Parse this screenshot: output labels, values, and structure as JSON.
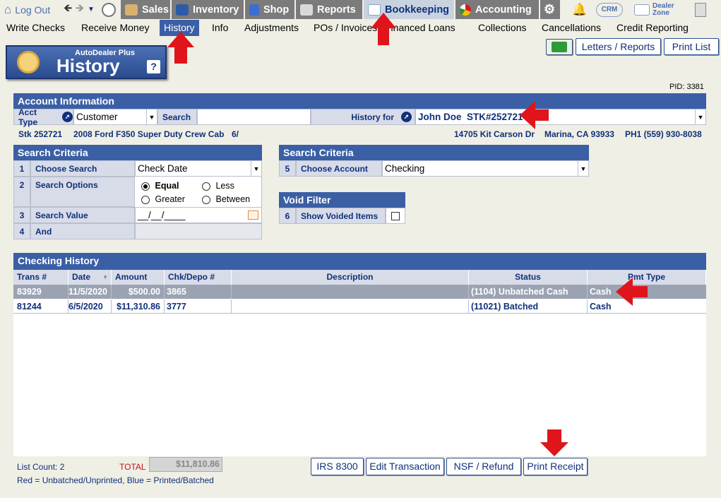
{
  "topbar": {
    "logout": "Log Out",
    "tabs": [
      "Sales",
      "Inventory",
      "Shop",
      "Reports",
      "Bookkeeping",
      "Accounting"
    ],
    "crm": "CRM",
    "dealer_zone": "Dealer Zone"
  },
  "menu": [
    "Write Checks",
    "Receive Money",
    "History",
    "Info",
    "Adjustments",
    "POs / Invoices",
    "Financed Loans",
    "Collections",
    "Cancellations",
    "Credit Reporting"
  ],
  "buttons": {
    "letters": "Letters / Reports",
    "print_list": "Print List"
  },
  "badge": {
    "brand": "AutoDealer Plus",
    "title": "History",
    "help": "?"
  },
  "pid": "PID: 3381",
  "account": {
    "header": "Account Information",
    "acct_type_label": "Acct Type",
    "acct_type_value": "Customer",
    "search_label": "Search",
    "search_value": "",
    "history_for_label": "History for",
    "history_for_value": "John Doe  STK#252721",
    "stk": "Stk 252721",
    "vehicle": "2008 Ford F350 Super Duty Crew Cab",
    "vehicle_extra": "6/",
    "address": "14705 Kit Carson Dr",
    "city": "Marina, CA 93933",
    "phone": "PH1 (559) 930-8038"
  },
  "criteria": {
    "header": "Search Criteria",
    "rows": [
      {
        "n": "1",
        "label": "Choose Search",
        "value": "Check Date"
      },
      {
        "n": "2",
        "label": "Search Options"
      },
      {
        "n": "3",
        "label": "Search Value",
        "value": "__/__/____"
      },
      {
        "n": "4",
        "label": "And"
      }
    ],
    "options": [
      "Equal",
      "Less",
      "Greater",
      "Between"
    ]
  },
  "criteria2": {
    "header": "Search Criteria",
    "n": "5",
    "label": "Choose Account",
    "value": "Checking"
  },
  "void": {
    "header": "Void Filter",
    "n": "6",
    "label": "Show Voided Items"
  },
  "history": {
    "header": "Checking History",
    "columns": [
      "Trans #",
      "Date",
      "Amount",
      "Chk/Depo #",
      "Description",
      "Status",
      "Pmt Type"
    ],
    "rows": [
      {
        "trans": "83929",
        "date": "11/5/2020",
        "amount": "$500.00",
        "chk": "3865",
        "desc": "",
        "status": "(1104) Unbatched Cash",
        "pmt": "Cash"
      },
      {
        "trans": "81244",
        "date": "6/5/2020",
        "amount": "$11,310.86",
        "chk": "3777",
        "desc": "",
        "status": "(11021) Batched",
        "pmt": "Cash"
      }
    ]
  },
  "footer": {
    "list_count": "List Count: 2",
    "total_label": "TOTAL",
    "total_value": "$11,810.86",
    "legend": "Red = Unbatched/Unprinted, Blue = Printed/Batched",
    "btn_irs": "IRS 8300",
    "btn_edit": "Edit Transaction",
    "btn_nsf": "NSF / Refund",
    "btn_print": "Print Receipt"
  },
  "colors": {
    "header_blue": "#3b5fa5",
    "label_bg": "#d7dce8",
    "selected_row": "#9ba3b3",
    "arrow_red": "#e0141b"
  }
}
